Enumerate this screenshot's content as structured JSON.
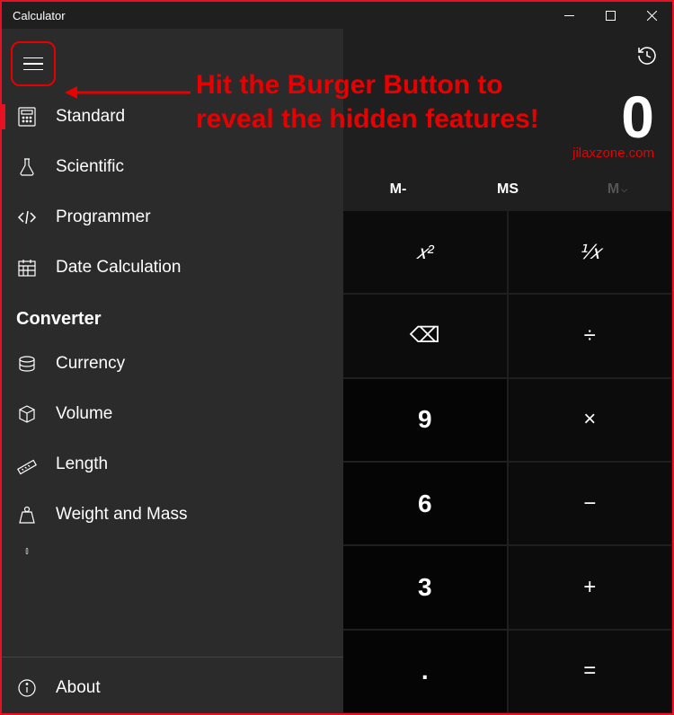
{
  "titlebar": {
    "title": "Calculator"
  },
  "sidebar": {
    "items": [
      {
        "label": "Standard",
        "icon": "calculator-icon",
        "active": true
      },
      {
        "label": "Scientific",
        "icon": "flask-icon"
      },
      {
        "label": "Programmer",
        "icon": "code-icon"
      },
      {
        "label": "Date Calculation",
        "icon": "calendar-icon"
      }
    ],
    "section_header": "Converter",
    "converter_items": [
      {
        "label": "Currency",
        "icon": "currency-icon"
      },
      {
        "label": "Volume",
        "icon": "cube-icon"
      },
      {
        "label": "Length",
        "icon": "ruler-icon"
      },
      {
        "label": "Weight and Mass",
        "icon": "weight-icon"
      }
    ],
    "about": {
      "label": "About"
    }
  },
  "display": {
    "value": "0"
  },
  "watermark": "jilaxzone.com",
  "memory": {
    "m_minus": "M-",
    "ms": "MS",
    "m_dropdown": "M"
  },
  "keypad": {
    "xsq": "𝑥²",
    "inv": "⅟𝑥",
    "back": "⌫",
    "div": "÷",
    "nine": "9",
    "mul": "×",
    "six": "6",
    "sub": "−",
    "three": "3",
    "add": "+",
    "dot": ".",
    "eq": "="
  },
  "annotation": {
    "text": "Hit the Burger Button to reveal the hidden features!"
  },
  "colors": {
    "accent": "#e81123",
    "annotation": "#e60000"
  }
}
